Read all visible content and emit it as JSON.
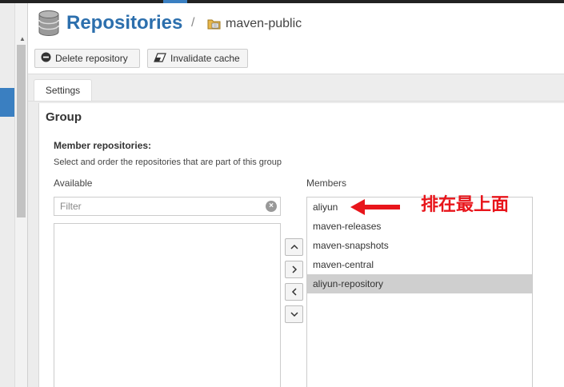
{
  "header": {
    "title": "Repositories",
    "separator": "/",
    "current_repo": "maven-public"
  },
  "toolbar": {
    "delete_label": "Delete repository",
    "invalidate_label": "Invalidate cache"
  },
  "tabs": [
    {
      "label": "Settings",
      "active": true
    }
  ],
  "group": {
    "title": "Group",
    "member_repositories_label": "Member repositories:",
    "help_text": "Select and order the repositories that are part of this group",
    "available_label": "Available",
    "members_label": "Members",
    "filter_placeholder": "Filter",
    "available_items": [],
    "members": [
      {
        "name": "aliyun",
        "selected": false
      },
      {
        "name": "maven-releases",
        "selected": false
      },
      {
        "name": "maven-snapshots",
        "selected": false
      },
      {
        "name": "maven-central",
        "selected": false
      },
      {
        "name": "aliyun-repository",
        "selected": true
      }
    ]
  },
  "annotation": {
    "text": "排在最上面",
    "color": "#e8151b"
  },
  "colors": {
    "accent": "#2c6fad",
    "nav_active": "#3a7fc1",
    "selected_row": "#cfcfcf"
  },
  "icons": [
    "database-icon",
    "folder-icon",
    "minus-circle-icon",
    "eraser-icon",
    "clear-icon",
    "chevron-up-icon",
    "chevron-right-icon",
    "chevron-left-icon",
    "chevron-down-icon",
    "red-arrow-icon"
  ]
}
